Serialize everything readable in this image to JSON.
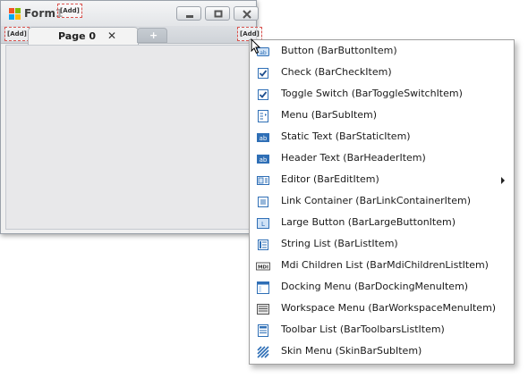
{
  "form": {
    "title": "Form1",
    "add_marker": "[Add]",
    "tabs": [
      {
        "label": "Page 0",
        "close_glyph": "✕"
      },
      {
        "new_glyph": "+"
      }
    ]
  },
  "menu": {
    "items": [
      {
        "label": "Button (BarButtonItem)",
        "icon": "button-icon"
      },
      {
        "label": "Check (BarCheckItem)",
        "icon": "checkbox-icon"
      },
      {
        "label": "Toggle Switch (BarToggleSwitchItem)",
        "icon": "checkbox-icon"
      },
      {
        "label": "Menu (BarSubItem)",
        "icon": "submenu-icon"
      },
      {
        "label": "Static Text (BarStaticItem)",
        "icon": "static-text-icon",
        "icon_text": "ab"
      },
      {
        "label": "Header Text (BarHeaderItem)",
        "icon": "header-text-icon",
        "icon_text": "ab"
      },
      {
        "label": "Editor (BarEditItem)",
        "icon": "editor-icon",
        "has_submenu": true
      },
      {
        "label": "Link Container (BarLinkContainerItem)",
        "icon": "link-container-icon"
      },
      {
        "label": "Large Button (BarLargeButtonItem)",
        "icon": "large-button-icon"
      },
      {
        "label": "String List (BarListItem)",
        "icon": "string-list-icon"
      },
      {
        "label": "Mdi Children List (BarMdiChildrenListItem)",
        "icon": "mdi-list-icon",
        "icon_text": "MDI"
      },
      {
        "label": "Docking Menu (BarDockingMenuItem)",
        "icon": "docking-menu-icon"
      },
      {
        "label": "Workspace Menu (BarWorkspaceMenuItem)",
        "icon": "workspace-menu-icon"
      },
      {
        "label": "Toolbar List (BarToolbarsListItem)",
        "icon": "toolbar-list-icon"
      },
      {
        "label": "Skin Menu (SkinBarSubItem)",
        "icon": "skin-menu-icon"
      }
    ]
  },
  "colors": {
    "icon_blue": "#2f6fb6",
    "add_marker_border": "#d9534f"
  }
}
